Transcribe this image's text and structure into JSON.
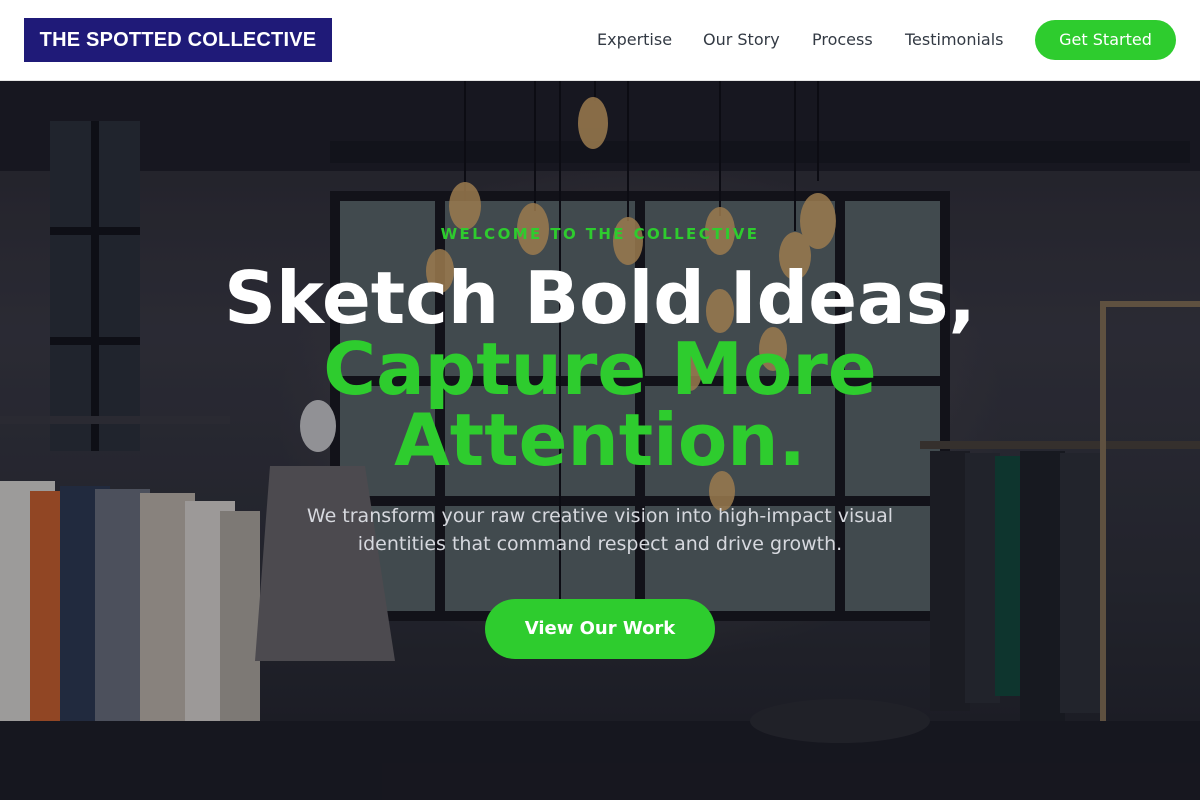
{
  "header": {
    "logo": "THE SPOTTED COLLECTIVE",
    "nav": [
      "Expertise",
      "Our Story",
      "Process",
      "Testimonials"
    ],
    "cta": "Get Started"
  },
  "hero": {
    "eyebrow": "WELCOME TO THE COLLECTIVE",
    "headline_line1": "Sketch Bold Ideas,",
    "headline_line2": "Capture More",
    "headline_line3": "Attention.",
    "subtext": "We transform your raw creative vision into high-impact visual identities that command respect and drive growth.",
    "button": "View Our Work",
    "background_image": "boutique-interior-photo"
  },
  "colors": {
    "brand_navy": "#1f1a78",
    "accent_green": "#2ecc2e",
    "text_dark": "#333a44"
  }
}
